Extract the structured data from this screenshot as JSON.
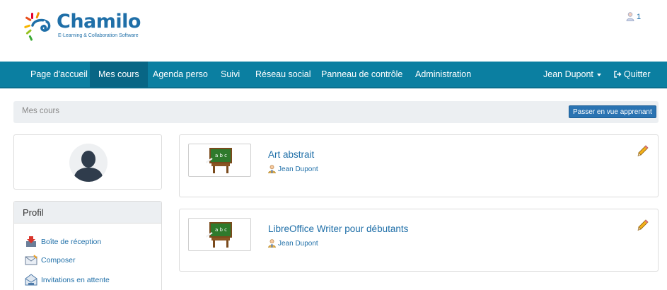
{
  "brand": {
    "name": "Chamilo",
    "tagline": "E-Learning & Collaboration Software",
    "color": "#1f6fa8"
  },
  "notifications": {
    "count": "1",
    "icon": "user-icon"
  },
  "navbar": {
    "color": "#0b7fa1",
    "items": [
      {
        "label": "Page d'accueil",
        "active": false
      },
      {
        "label": "Mes cours",
        "active": true
      },
      {
        "label": "Agenda perso",
        "active": false
      },
      {
        "label": "Suivi",
        "active": false
      },
      {
        "label": "Réseau social",
        "active": false
      },
      {
        "label": "Panneau de contrôle",
        "active": false
      },
      {
        "label": "Administration",
        "active": false
      }
    ],
    "user_menu": "Jean Dupont",
    "logout": "Quitter"
  },
  "breadcrumb": {
    "current": "Mes cours",
    "student_view_button": "Passer en vue apprenant"
  },
  "sidebar": {
    "profile_title": "Profil",
    "links": [
      {
        "label": "Boîte de réception",
        "icon": "inbox-icon"
      },
      {
        "label": "Composer",
        "icon": "compose-icon"
      },
      {
        "label": "Invitations en attente",
        "icon": "invitations-icon"
      }
    ]
  },
  "courses": [
    {
      "title": "Art abstrait",
      "teacher": "Jean Dupont",
      "icon": "blackboard-icon"
    },
    {
      "title": "LibreOffice Writer pour débutants",
      "teacher": "Jean Dupont",
      "icon": "blackboard-icon"
    }
  ]
}
